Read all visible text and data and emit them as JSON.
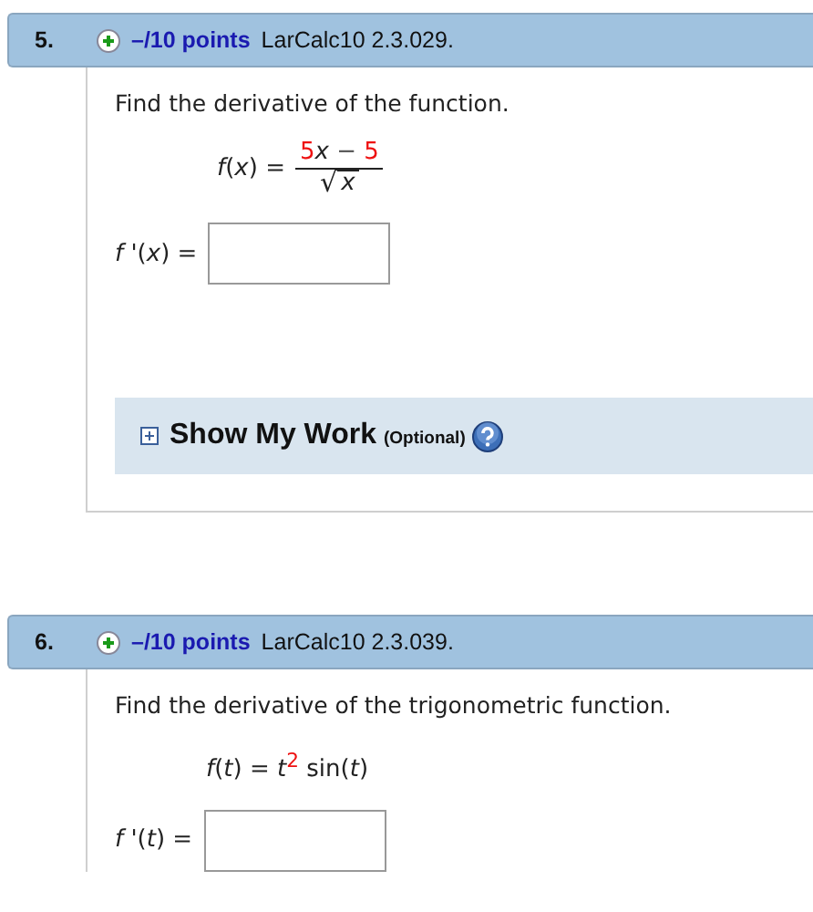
{
  "questions": [
    {
      "number": "5.",
      "points": "–/10 points",
      "source": "LarCalc10 2.3.029.",
      "prompt": "Find the derivative of the function.",
      "formula": {
        "kind": "fraction",
        "lhs": "*f*(*x*) =",
        "numerator": [
          {
            "text": "5",
            "color": "#ee1111"
          },
          {
            "text": "*x*",
            "color": "#222222"
          },
          {
            "text": " − ",
            "color": "#555555"
          },
          {
            "text": "5",
            "color": "#ee1111"
          }
        ],
        "radical": "√",
        "radicand": "*x*"
      },
      "answer_label": "*f* '(*x*) =",
      "show_my_work": {
        "title": "Show My Work",
        "note": "(Optional)",
        "expanded": false
      }
    },
    {
      "number": "6.",
      "points": "–/10 points",
      "source": "LarCalc10 2.3.039.",
      "prompt": "Find the derivative of the trigonometric function.",
      "formula": {
        "kind": "inline",
        "segments": [
          {
            "text": "*f*(*t*) = *t*",
            "color": "#222222"
          },
          {
            "text": "$^{2}$",
            "color": "#ee1111"
          },
          {
            "text": " sin(*t*)",
            "color": "#222222"
          }
        ]
      },
      "answer_label": "*f* '(*t*) ="
    }
  ]
}
